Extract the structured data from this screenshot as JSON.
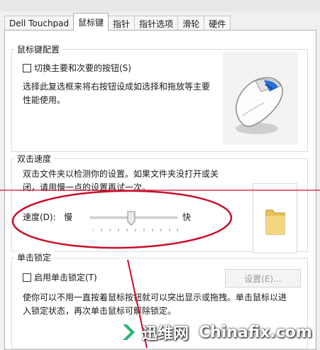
{
  "tabs": [
    {
      "label": "Dell Touchpad",
      "active": false
    },
    {
      "label": "鼠标键",
      "active": true
    },
    {
      "label": "指针",
      "active": false
    },
    {
      "label": "指针选项",
      "active": false
    },
    {
      "label": "滑轮",
      "active": false
    },
    {
      "label": "硬件",
      "active": false
    }
  ],
  "button_config": {
    "title": "鼠标键配置",
    "swap_checkbox_label": "切换主要和次要的按钮(S)",
    "description_line1": "选择此复选框来将右按钮设成如选择和拖放等主要",
    "description_line2": "性能使用。"
  },
  "double_click": {
    "title": "双击速度",
    "description_line1": "双击文件夹以检测你的设置。如果文件夹没打开或关",
    "description_line2": "闭，请用慢一点的设置再试一次。",
    "speed_label": "速度(D):",
    "slow_label": "慢",
    "fast_label": "快",
    "speed_level": 0.45
  },
  "click_lock": {
    "title": "单击锁定",
    "checkbox_label": "启用单击锁定(T)",
    "settings_button": "设置(E)...",
    "description_line1": "使你可以不用一直按着鼠标按钮就可以突出显示或拖拽。单击鼠标以进",
    "description_line2": "入锁定状态，再次单击鼠标可解除锁定。"
  },
  "watermark": {
    "brand_cn": "迅维网",
    "brand_en": "Chinafix.com"
  },
  "colors": {
    "annotation_red": "#c8102e",
    "accent_blue": "#2b6fd6"
  }
}
